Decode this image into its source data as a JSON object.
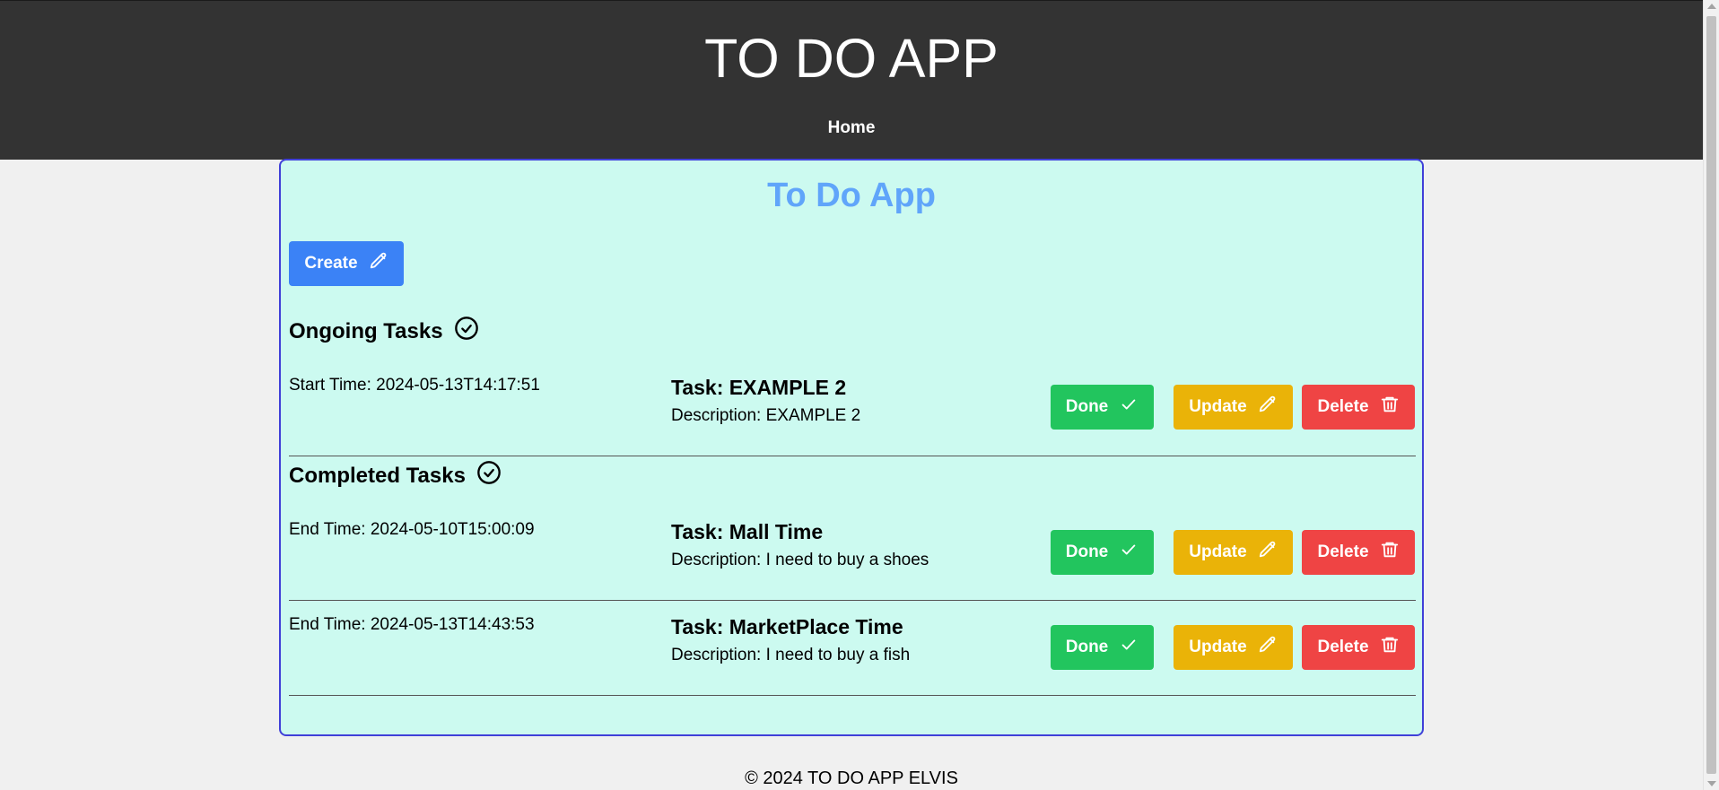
{
  "header": {
    "title": "TO DO APP",
    "nav": {
      "home": "Home"
    }
  },
  "main": {
    "title": "To Do App",
    "create_label": "Create",
    "ongoing": {
      "heading": "Ongoing Tasks",
      "tasks": [
        {
          "time": "Start Time: 2024-05-13T14:17:51",
          "name": "Task: EXAMPLE 2",
          "description": "Description: EXAMPLE 2"
        }
      ]
    },
    "completed": {
      "heading": "Completed Tasks",
      "tasks": [
        {
          "time": "End Time: 2024-05-10T15:00:09",
          "name": "Task: Mall Time",
          "description": "Description: I need to buy a shoes"
        },
        {
          "time": "End Time: 2024-05-13T14:43:53",
          "name": "Task: MarketPlace Time",
          "description": "Description: I need to buy a fish"
        }
      ]
    },
    "actions": {
      "done_label": "Done",
      "update_label": "Update",
      "delete_label": "Delete"
    }
  },
  "footer": {
    "text": "© 2024 TO DO APP ELVIS"
  },
  "icons": {
    "create": "pencil-icon",
    "section": "check-circle-icon",
    "done": "check-icon",
    "update": "pencil-icon",
    "delete": "trash-icon"
  },
  "colors": {
    "header_bg": "#333333",
    "card_bg": "#ccfaf0",
    "card_border": "#4040d8",
    "title": "#60a5fa",
    "create": "#3b82f6",
    "done": "#22c55e",
    "update": "#eab308",
    "delete": "#ef4444"
  }
}
